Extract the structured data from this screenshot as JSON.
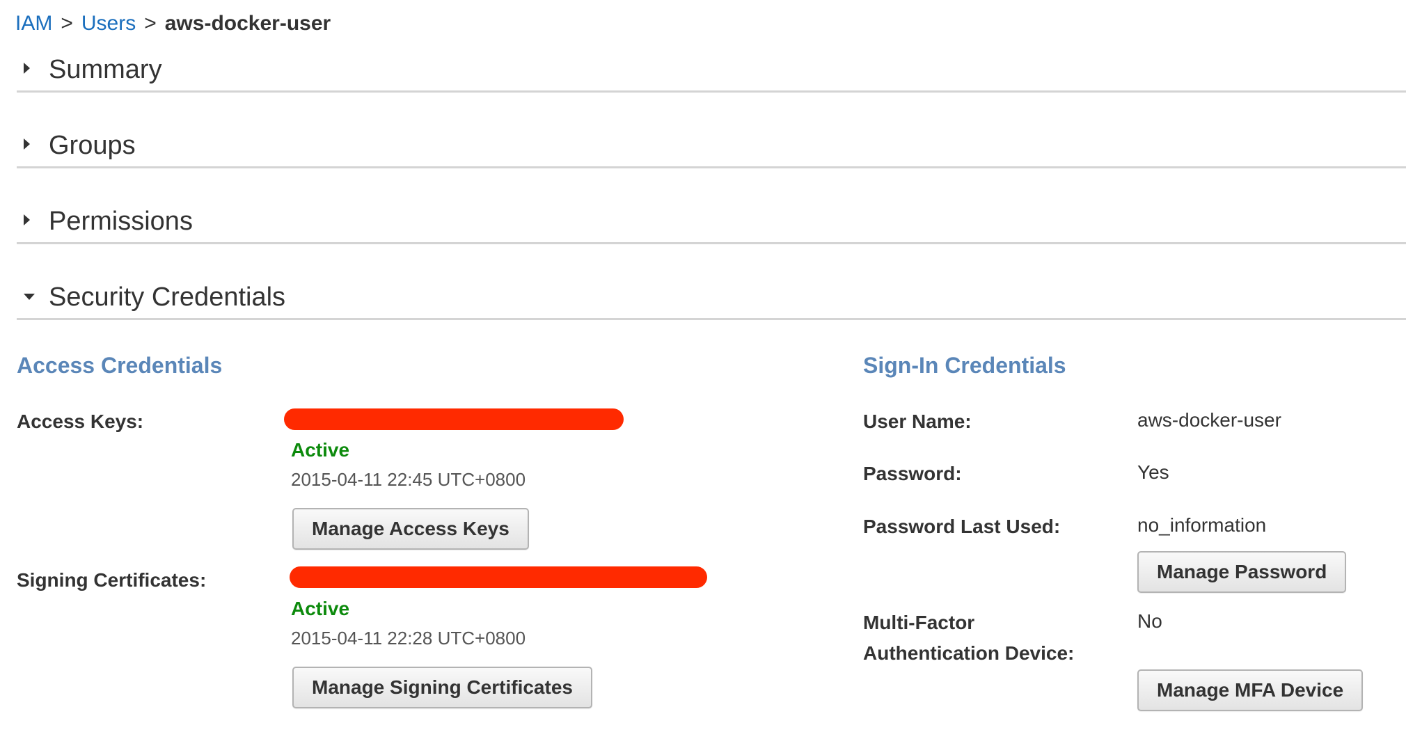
{
  "breadcrumb": {
    "root": "IAM",
    "separator": ">",
    "users": "Users",
    "current": "aws-docker-user"
  },
  "sections": {
    "summary": "Summary",
    "groups": "Groups",
    "permissions": "Permissions",
    "security_credentials": "Security Credentials"
  },
  "access_credentials": {
    "heading": "Access Credentials",
    "access_keys": {
      "label": "Access Keys:",
      "status": "Active",
      "date": "2015-04-11 22:45 UTC+0800",
      "button": "Manage Access Keys"
    },
    "signing_certificates": {
      "label": "Signing Certificates:",
      "status": "Active",
      "date": "2015-04-11 22:28 UTC+0800",
      "button": "Manage Signing Certificates"
    }
  },
  "signin_credentials": {
    "heading": "Sign-In Credentials",
    "user_name": {
      "label": "User Name:",
      "value": "aws-docker-user"
    },
    "password": {
      "label": "Password:",
      "value": "Yes"
    },
    "password_last_used": {
      "label": "Password Last Used:",
      "value": "no_information"
    },
    "manage_password_button": "Manage Password",
    "mfa": {
      "label_line1": "Multi-Factor",
      "label_line2": "Authentication Device:",
      "value": "No",
      "button": "Manage MFA Device"
    }
  },
  "colors": {
    "link": "#1a6ebd",
    "subheading": "#5a86b8",
    "active": "#0c8a0c",
    "redaction": "#ff2a00",
    "divider": "#d4d4d4"
  }
}
